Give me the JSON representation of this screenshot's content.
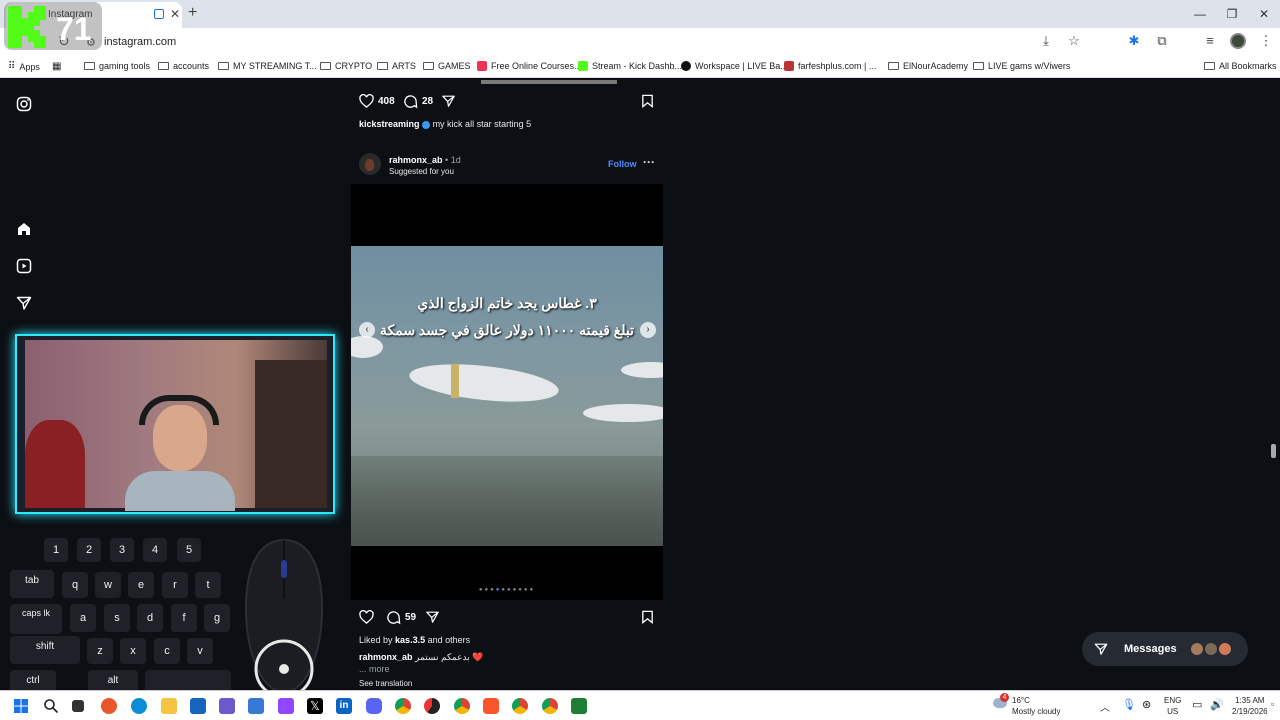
{
  "browser": {
    "tab_title": "Instagram",
    "url": "instagram.com",
    "bookmarks": [
      {
        "label": "Apps"
      },
      {
        "label": "gaming tools"
      },
      {
        "label": "accounts"
      },
      {
        "label": "MY STREAMING T..."
      },
      {
        "label": "CRYPTO"
      },
      {
        "label": "ARTS"
      },
      {
        "label": "GAMES"
      },
      {
        "label": "Free Online Courses..."
      },
      {
        "label": "Stream - Kick Dashb..."
      },
      {
        "label": "Workspace | LIVE Ba..."
      },
      {
        "label": "farfeshplus.com | ..."
      },
      {
        "label": "ElNourAcademy"
      },
      {
        "label": "LIVE gams w/Viwers"
      }
    ],
    "all_bookmarks": "All Bookmarks"
  },
  "post1": {
    "likes": "408",
    "comments": "28",
    "username": "kickstreaming",
    "caption": "my kick all star starting 5"
  },
  "post2": {
    "username": "rahmonx_ab",
    "age": "1d",
    "subtitle": "Suggested for you",
    "follow": "Follow",
    "overlay_line1": "٣. غطاس يجد خاتم الزواج الذي",
    "overlay_line2": "تبلغ قيمته ١١٠٠٠ دولار عالق في جسد سمكة",
    "comments": "59",
    "liked_by_prefix": "Liked by",
    "liked_by_user": "kas.3.5",
    "liked_by_suffix": "and others",
    "caption_user": "rahmonx_ab",
    "caption": "بدعمكم نستمر ❤️",
    "more": "... more",
    "see_translation": "See translation"
  },
  "overlay": {
    "counter": "71",
    "keys_numbers": [
      "1",
      "2",
      "3",
      "4",
      "5"
    ],
    "keys_row2": [
      "tab",
      "q",
      "w",
      "e",
      "r",
      "t"
    ],
    "keys_row3": [
      "caps lk",
      "a",
      "s",
      "d",
      "f",
      "g"
    ],
    "keys_row4": [
      "shift",
      "z",
      "x",
      "c",
      "v"
    ],
    "keys_row5": [
      "ctrl",
      "alt"
    ]
  },
  "messages_label": "Messages",
  "taskbar": {
    "weather_temp": "16°C",
    "weather_desc": "Mostly cloudy",
    "weather_badge": "4",
    "lang1": "ENG",
    "lang2": "US",
    "time": "1:35 AM",
    "date": "2/19/2026"
  },
  "colors": {
    "accent_follow": "#4a8cff",
    "webcam_glow": "#2ee8ff",
    "kick_green": "#53fc18"
  }
}
